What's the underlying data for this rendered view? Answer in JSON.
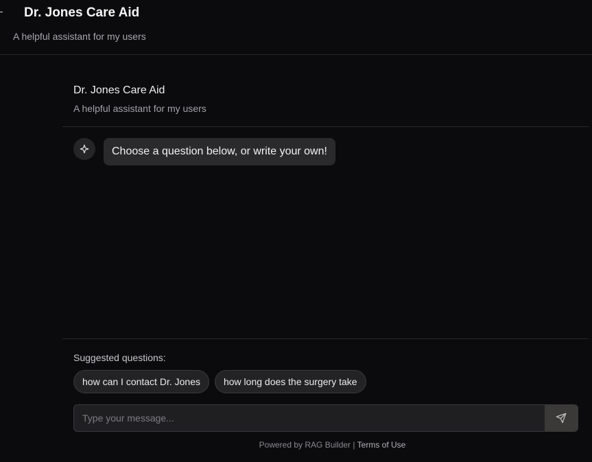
{
  "app": {
    "title": "Dr. Jones Care Aid",
    "subtitle": "A helpful assistant for my users"
  },
  "chat": {
    "title": "Dr. Jones Care Aid",
    "subtitle": "A helpful assistant for my users",
    "messages": [
      {
        "role": "assistant",
        "icon": "sparkle-icon",
        "text": "Choose a question below, or write your own!"
      }
    ],
    "suggested_label": "Suggested questions:",
    "suggestions": [
      "how can I contact Dr. Jones",
      "how long does the surgery take"
    ],
    "input": {
      "placeholder": "Type your message...",
      "value": ""
    },
    "send_icon": "send-icon"
  },
  "footer": {
    "powered_by": "Powered by RAG Builder",
    "separator": "|",
    "terms": "Terms of Use"
  }
}
